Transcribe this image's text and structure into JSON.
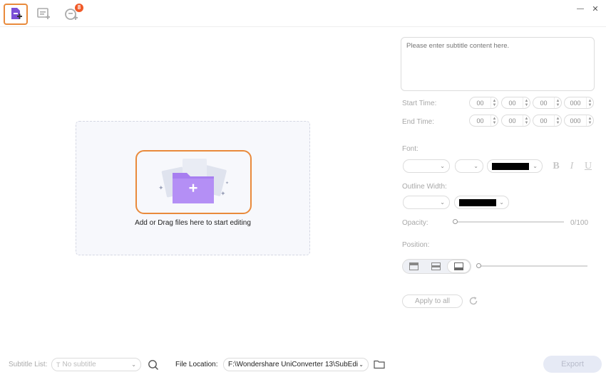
{
  "toolbar": {
    "items": [
      {
        "name": "add-file",
        "icon": "add-file-icon",
        "active": true
      },
      {
        "name": "add-subtitle",
        "icon": "add-subtitle-icon",
        "active": false
      },
      {
        "name": "auto-subtitle",
        "icon": "auto-subtitle-icon",
        "badge": "8",
        "active": false
      }
    ],
    "window": {
      "minimize": "—",
      "close": "✕"
    }
  },
  "dropzone": {
    "text": "Add or Drag files here to start editing",
    "icon": "folder-plus-icon",
    "accent": "#e98a3b",
    "folder_color": "#a77ef0"
  },
  "editor": {
    "subtitle_placeholder": "Please enter subtitle content here.",
    "start_time_label": "Start Time:",
    "end_time_label": "End Time:",
    "start_time": [
      "00",
      "00",
      "00",
      "000"
    ],
    "end_time": [
      "00",
      "00",
      "00",
      "000"
    ],
    "font_label": "Font:",
    "font_color": "#000000",
    "bold": "B",
    "italic": "I",
    "underline": "U",
    "outline_width_label": "Outline Width:",
    "outline_color": "#000000",
    "opacity_label": "Opacity:",
    "opacity_value": "0/100",
    "opacity": 0,
    "position_label": "Position:",
    "position_icons": [
      "position-top-icon",
      "position-middle-icon",
      "position-bottom-icon"
    ],
    "position_selected": "bottom",
    "position_offset": 0,
    "apply_all": "Apply to all"
  },
  "footer": {
    "subtitle_list_label": "Subtitle List:",
    "subtitle_select": "No subtitle",
    "file_location_label": "File Location:",
    "file_location": "F:\\Wondershare UniConverter 13\\SubEdi",
    "export": "Export"
  }
}
